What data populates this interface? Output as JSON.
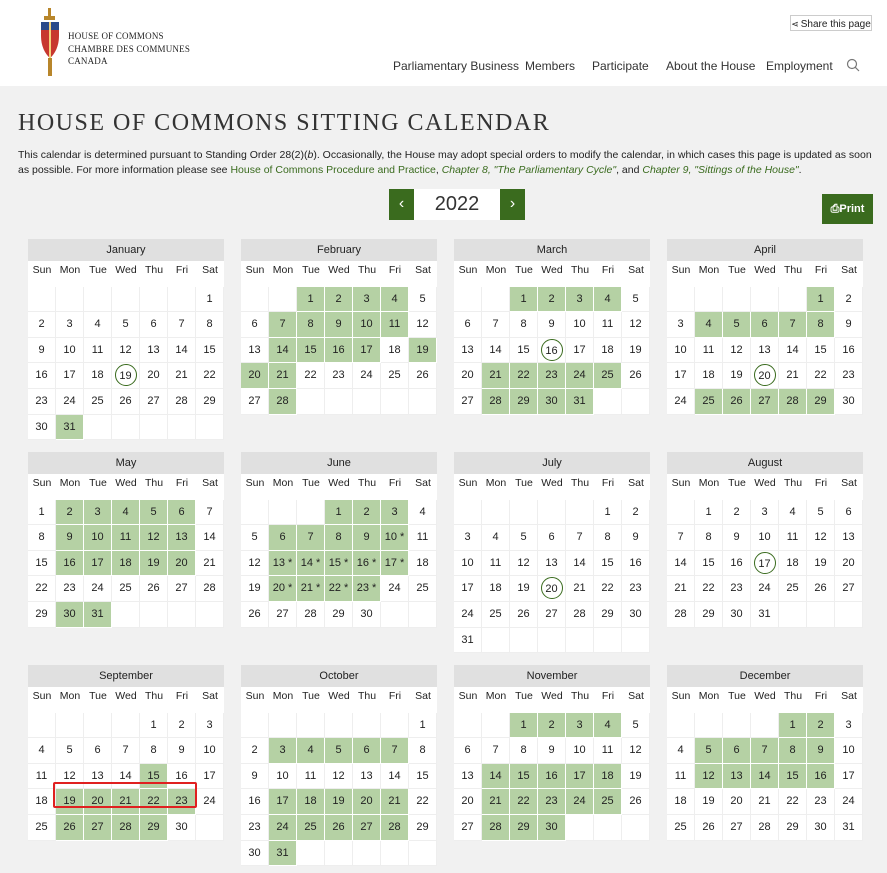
{
  "header": {
    "logo_lines": [
      "HOUSE OF COMMONS",
      "CHAMBRE DES COMMUNES",
      "CANADA"
    ],
    "share_label": "Share this page",
    "nav": [
      "Parliamentary Business",
      "Members",
      "Participate",
      "About the House",
      "Employment"
    ]
  },
  "page": {
    "title": "HOUSE OF COMMONS SITTING CALENDAR",
    "desc_1": "This calendar is determined pursuant to Standing Order 28(2)(",
    "desc_b": "b",
    "desc_2": "). Occasionally, the House may adopt special orders to modify the calendar, in which cases this page is updated as soon as possible. For more information please see ",
    "desc_link": "House of Commons Procedure and Practice",
    "desc_3": ", ",
    "desc_ch8": "Chapter 8, \"The Parliamentary Cycle\"",
    "desc_4": ", and ",
    "desc_ch9": "Chapter 9, \"Sittings of the House\"",
    "desc_5": ".",
    "year": "2022",
    "prev": "‹",
    "next": "›",
    "print_label": "Print"
  },
  "weekdays": [
    "Sun",
    "Mon",
    "Tue",
    "Wed",
    "Thu",
    "Fri",
    "Sat"
  ],
  "months": [
    {
      "name": "January",
      "offset": 6,
      "days": 31,
      "sitting": [
        31
      ],
      "circled": [
        19
      ],
      "starred": []
    },
    {
      "name": "February",
      "offset": 2,
      "days": 28,
      "sitting": [
        1,
        2,
        3,
        4,
        7,
        8,
        9,
        10,
        11,
        14,
        15,
        16,
        17,
        19,
        20,
        21,
        28
      ],
      "circled": [],
      "starred": []
    },
    {
      "name": "March",
      "offset": 2,
      "days": 31,
      "sitting": [
        1,
        2,
        3,
        4,
        21,
        22,
        23,
        24,
        25,
        28,
        29,
        30,
        31
      ],
      "circled": [
        16
      ],
      "starred": []
    },
    {
      "name": "April",
      "offset": 5,
      "days": 30,
      "sitting": [
        1,
        4,
        5,
        6,
        7,
        8,
        25,
        26,
        27,
        28,
        29
      ],
      "circled": [
        20
      ],
      "starred": []
    },
    {
      "name": "May",
      "offset": 0,
      "days": 31,
      "sitting": [
        2,
        3,
        4,
        5,
        6,
        9,
        10,
        11,
        12,
        13,
        16,
        17,
        18,
        19,
        20,
        30,
        31
      ],
      "circled": [],
      "starred": []
    },
    {
      "name": "June",
      "offset": 3,
      "days": 30,
      "sitting": [
        1,
        2,
        3,
        6,
        7,
        8,
        9,
        10,
        13,
        14,
        15,
        16,
        17,
        20,
        21,
        22,
        23
      ],
      "circled": [],
      "starred": [
        10,
        13,
        14,
        15,
        16,
        17,
        20,
        21,
        22,
        23
      ]
    },
    {
      "name": "July",
      "offset": 5,
      "days": 31,
      "sitting": [],
      "circled": [
        20
      ],
      "starred": []
    },
    {
      "name": "August",
      "offset": 1,
      "days": 31,
      "sitting": [],
      "circled": [
        17
      ],
      "starred": []
    },
    {
      "name": "September",
      "offset": 4,
      "days": 30,
      "sitting": [
        15,
        19,
        20,
        21,
        22,
        23,
        26,
        27,
        28,
        29
      ],
      "circled": [],
      "starred": []
    },
    {
      "name": "October",
      "offset": 6,
      "days": 31,
      "sitting": [
        3,
        4,
        5,
        6,
        7,
        17,
        18,
        19,
        20,
        21,
        24,
        25,
        26,
        27,
        28,
        31
      ],
      "circled": [],
      "starred": []
    },
    {
      "name": "November",
      "offset": 2,
      "days": 30,
      "sitting": [
        1,
        2,
        3,
        4,
        14,
        15,
        16,
        17,
        18,
        21,
        22,
        23,
        24,
        25,
        28,
        29,
        30
      ],
      "circled": [],
      "starred": []
    },
    {
      "name": "December",
      "offset": 4,
      "days": 31,
      "sitting": [
        1,
        2,
        5,
        6,
        7,
        8,
        9,
        12,
        13,
        14,
        15,
        16
      ],
      "circled": [],
      "starred": []
    }
  ],
  "colors": {
    "accent": "#3a6b1e",
    "sitting": "#b5d1a4",
    "highlight": "#e02020"
  }
}
